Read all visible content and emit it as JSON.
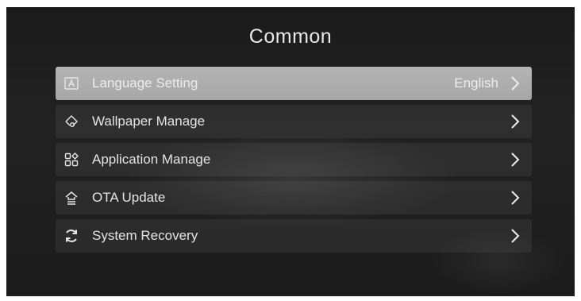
{
  "page": {
    "title": "Common"
  },
  "menu": {
    "items": [
      {
        "label": "Language Setting",
        "value": "English",
        "icon": "language-icon",
        "selected": true
      },
      {
        "label": "Wallpaper Manage",
        "value": "",
        "icon": "wallpaper-icon",
        "selected": false
      },
      {
        "label": "Application Manage",
        "value": "",
        "icon": "apps-grid-icon",
        "selected": false
      },
      {
        "label": "OTA Update",
        "value": "",
        "icon": "ota-update-icon",
        "selected": false
      },
      {
        "label": "System Recovery",
        "value": "",
        "icon": "recovery-icon",
        "selected": false
      }
    ]
  },
  "colors": {
    "background": "#1e1e1e",
    "selected_row": "#aeaeae",
    "text": "#e6e6e6"
  }
}
